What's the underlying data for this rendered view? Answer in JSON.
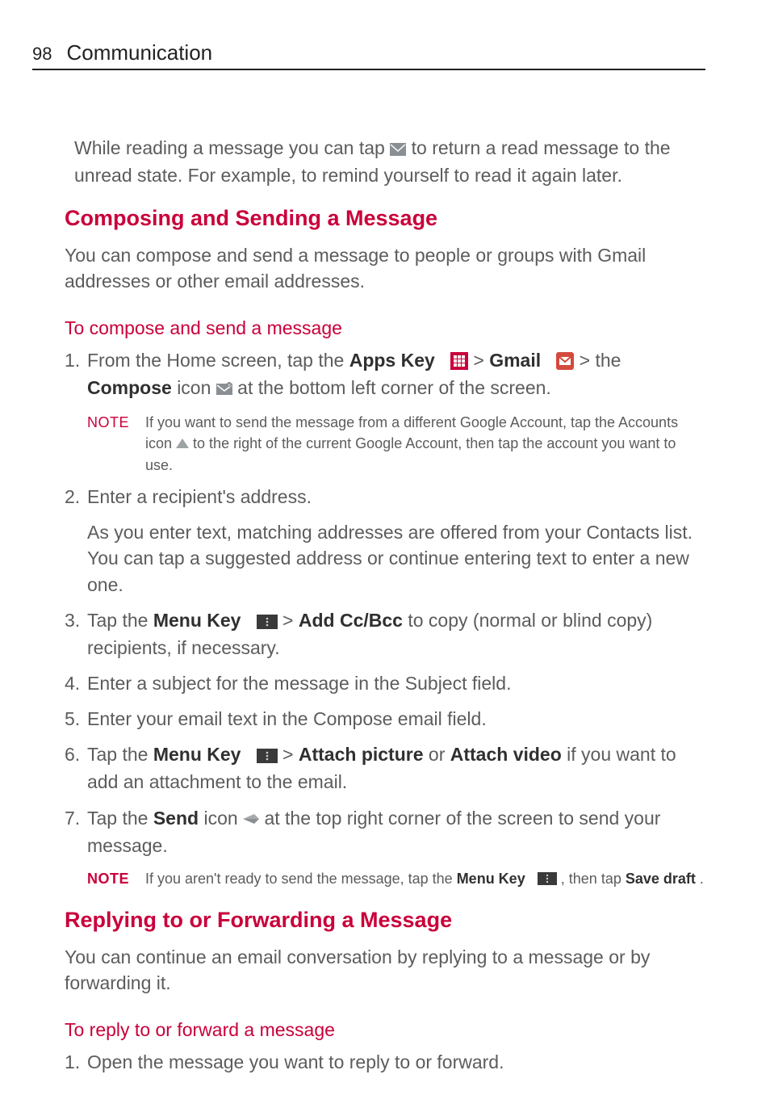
{
  "page_number": "98",
  "chapter_title": "Communication",
  "intro_para_a": "While reading a message you can tap ",
  "intro_para_b": " to return a read message to the unread state. For example, to remind yourself to read it again later.",
  "h_compose": "Composing and Sending a Message",
  "compose_intro": "You can compose and send a message to people or groups with Gmail addresses or other email addresses.",
  "h_to_compose": "To compose and send a message",
  "s1_num": "1.",
  "s1_a": "From the Home screen, tap the ",
  "s1_apps": "Apps Key",
  "s1_b": " > ",
  "s1_gmail": "Gmail",
  "s1_c": " > the ",
  "s1_compose": "Compose",
  "s1_d": " icon ",
  "s1_e": " at the bottom left corner of the screen.",
  "note1_label": "NOTE",
  "note1_a": "If you want to send the message from a different Google Account, tap the Accounts icon ",
  "note1_b": " to the right of the current Google Account, then tap the account you want to use.",
  "s2_num": "2.",
  "s2_a": "Enter a recipient's address.",
  "s2_cont": "As you enter text, matching addresses are offered from your Contacts list. You can tap a suggested address or continue entering text to enter a new one.",
  "s3_num": "3.",
  "s3_a": "Tap the ",
  "s3_menu": "Menu Key",
  "s3_b": " > ",
  "s3_addcc": "Add Cc/Bcc",
  "s3_c": " to copy (normal or blind copy) recipients, if necessary.",
  "s4_num": "4.",
  "s4_a": "Enter a subject for the message in the Subject field.",
  "s5_num": "5.",
  "s5_a": "Enter your email text in the Compose email field.",
  "s6_num": "6.",
  "s6_a": "Tap the ",
  "s6_menu": "Menu Key",
  "s6_b": " > ",
  "s6_att1": "Attach picture",
  "s6_or": " or ",
  "s6_att2": "Attach video",
  "s6_c": " if you want to add an attachment to the email.",
  "s7_num": "7.",
  "s7_a": "Tap the ",
  "s7_send": "Send",
  "s7_b": " icon ",
  "s7_c": " at the top right corner of the screen to send your message.",
  "note2_label": "NOTE",
  "note2_a": "If you aren't ready to send the message, tap the ",
  "note2_menu": "Menu Key",
  "note2_b": ", then tap ",
  "note2_save": "Save draft",
  "note2_c": ".",
  "h_reply": "Replying to or Forwarding a Message",
  "reply_intro": "You can continue an email conversation by replying to a message or by forwarding it.",
  "h_to_reply": "To reply to or forward a message",
  "r1_num": "1.",
  "r1_a": "Open the message you want to reply to or forward."
}
